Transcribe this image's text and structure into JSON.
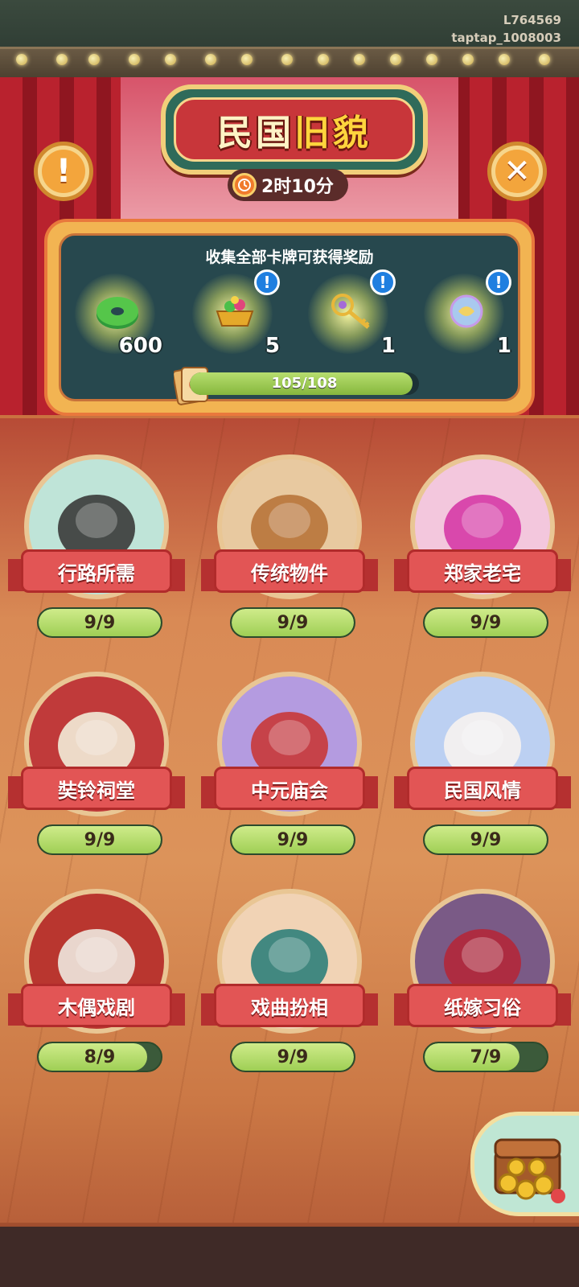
{
  "watermark": {
    "line1": "L764569",
    "line2": "taptap_1008003"
  },
  "header": {
    "title_part1": "民国",
    "title_part2": "旧貌",
    "timer": "2时10分",
    "info_icon": "exclamation-icon",
    "close_icon": "close-icon"
  },
  "reward": {
    "title": "收集全部卡牌可获得奖励",
    "items": [
      {
        "name": "jade-coin",
        "count": "600",
        "has_info": false
      },
      {
        "name": "treasure-basin",
        "count": "5",
        "has_info": true
      },
      {
        "name": "golden-key",
        "count": "1",
        "has_info": true
      },
      {
        "name": "magic-orb",
        "count": "1",
        "has_info": true
      }
    ],
    "progress_text": "105/108",
    "progress_value": 105,
    "progress_max": 108
  },
  "cards": [
    {
      "label": "行路所需",
      "progress": "9/9",
      "value": 9,
      "max": 9,
      "icon": "rickshaw-icon"
    },
    {
      "label": "传统物件",
      "progress": "9/9",
      "value": 9,
      "max": 9,
      "icon": "butterfly-box-icon"
    },
    {
      "label": "郑家老宅",
      "progress": "9/9",
      "value": 9,
      "max": 9,
      "icon": "spider-lily-icon"
    },
    {
      "label": "奘铃祠堂",
      "progress": "9/9",
      "value": 9,
      "max": 9,
      "icon": "gold-ingot-icon"
    },
    {
      "label": "中元庙会",
      "progress": "9/9",
      "value": 9,
      "max": 9,
      "icon": "lantern-icon"
    },
    {
      "label": "民国风情",
      "progress": "9/9",
      "value": 9,
      "max": 9,
      "icon": "gloves-icon"
    },
    {
      "label": "木偶戏剧",
      "progress": "8/9",
      "value": 8,
      "max": 9,
      "icon": "puppet-icon"
    },
    {
      "label": "戏曲扮相",
      "progress": "9/9",
      "value": 9,
      "max": 9,
      "icon": "opera-actress-icon"
    },
    {
      "label": "纸嫁习俗",
      "progress": "7/9",
      "value": 7,
      "max": 9,
      "icon": "paper-bride-icon"
    }
  ],
  "chest_button": {
    "icon": "treasure-chest-icon"
  }
}
